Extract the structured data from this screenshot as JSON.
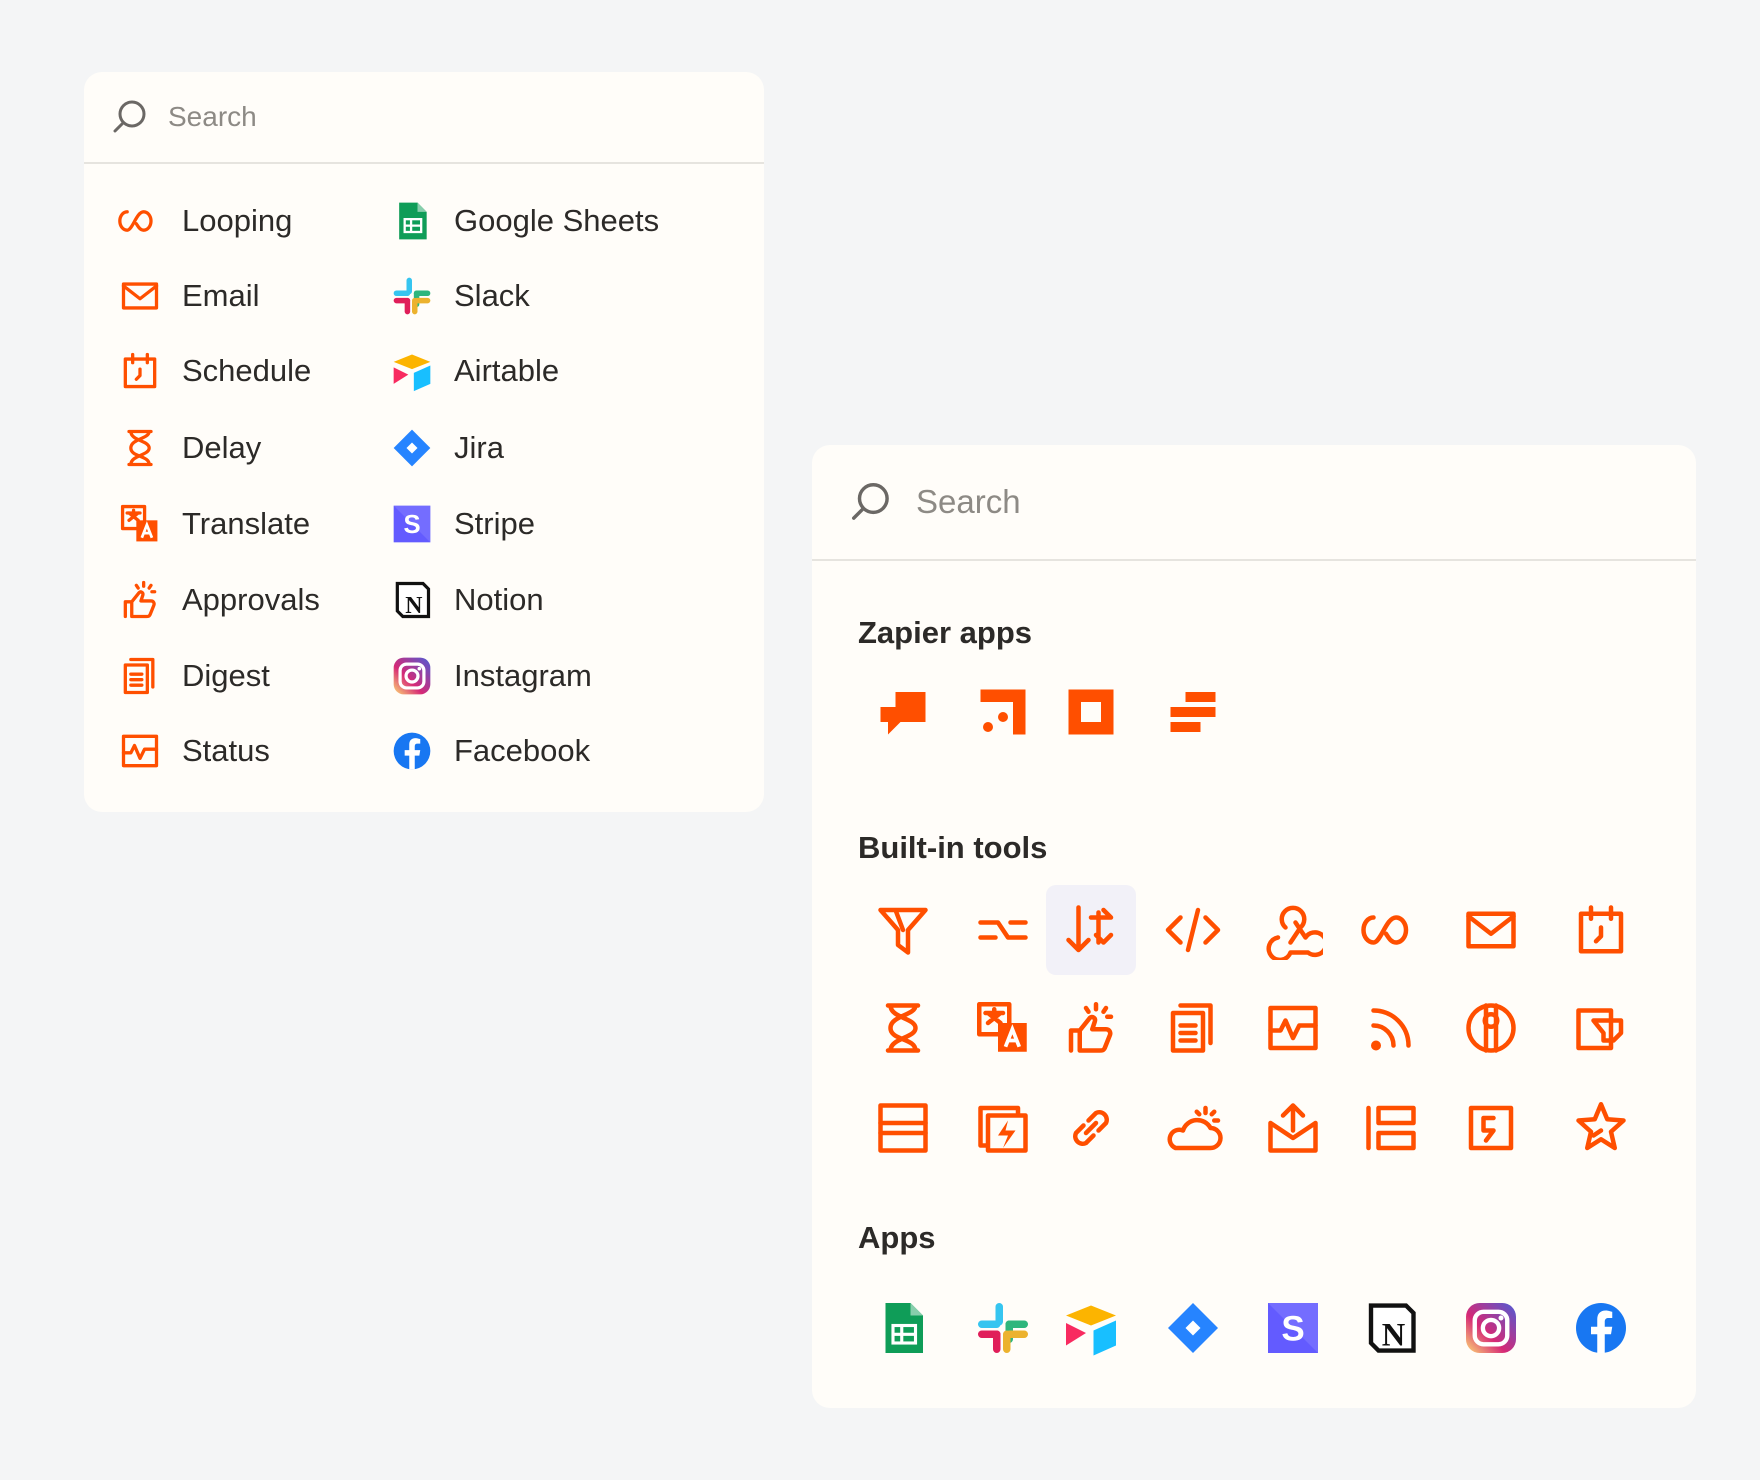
{
  "colors": {
    "accent": "#ff4f00",
    "text": "#2c2a28",
    "muted": "#8d8a85",
    "panel": "#fffdf9",
    "background": "#f4f5f6"
  },
  "left_panel": {
    "search": {
      "placeholder": "Search"
    },
    "tools": [
      {
        "label": "Looping",
        "icon": "looping-icon"
      },
      {
        "label": "Email",
        "icon": "email-icon"
      },
      {
        "label": "Schedule",
        "icon": "schedule-icon"
      },
      {
        "label": "Delay",
        "icon": "delay-icon"
      },
      {
        "label": "Translate",
        "icon": "translate-icon"
      },
      {
        "label": "Approvals",
        "icon": "approvals-icon"
      },
      {
        "label": "Digest",
        "icon": "digest-icon"
      },
      {
        "label": "Status",
        "icon": "status-icon"
      }
    ],
    "apps": [
      {
        "label": "Google Sheets",
        "icon": "google-sheets-icon"
      },
      {
        "label": "Slack",
        "icon": "slack-icon"
      },
      {
        "label": "Airtable",
        "icon": "airtable-icon"
      },
      {
        "label": "Jira",
        "icon": "jira-icon"
      },
      {
        "label": "Stripe",
        "icon": "stripe-icon"
      },
      {
        "label": "Notion",
        "icon": "notion-icon"
      },
      {
        "label": "Instagram",
        "icon": "instagram-icon"
      },
      {
        "label": "Facebook",
        "icon": "facebook-icon"
      }
    ]
  },
  "right_panel": {
    "search": {
      "placeholder": "Search"
    },
    "sections": {
      "zapier_apps": {
        "title": "Zapier apps",
        "icons": [
          "interfaces-icon",
          "tables-icon",
          "canvas-icon",
          "chatbots-icon"
        ]
      },
      "built_in_tools": {
        "title": "Built-in tools",
        "selected_icon": "formatter-icon",
        "icons": [
          "filter-icon",
          "paths-icon",
          "formatter-icon",
          "code-icon",
          "webhooks-icon",
          "looping-icon",
          "email-icon",
          "schedule-icon",
          "delay-icon",
          "translate-icon",
          "approvals-icon",
          "digest-icon",
          "status-icon",
          "rss-icon",
          "manager-icon",
          "web-parser-icon",
          "storage-icon",
          "sub-zap-icon",
          "url-shortener-icon",
          "weather-icon",
          "email-parser-icon",
          "lookup-table-icon",
          "transfer-icon",
          "bookmark-star-icon"
        ]
      },
      "apps": {
        "title": "Apps",
        "icons": [
          "google-sheets-icon",
          "slack-icon",
          "airtable-icon",
          "jira-icon",
          "stripe-icon",
          "notion-icon",
          "instagram-icon",
          "facebook-icon"
        ]
      }
    }
  }
}
